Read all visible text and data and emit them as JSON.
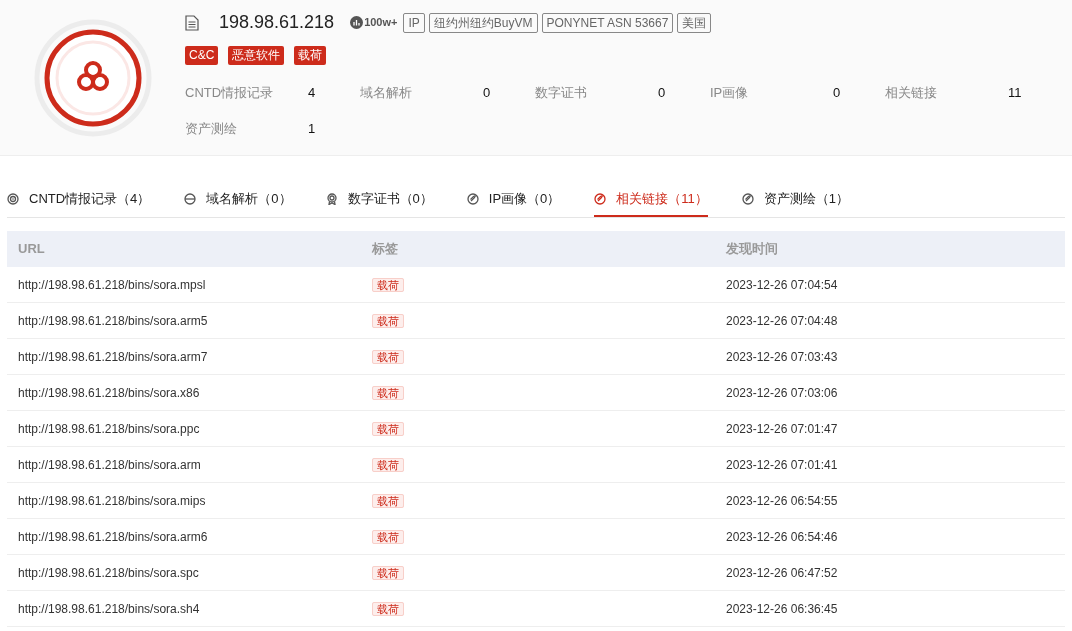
{
  "header": {
    "ip": "198.98.61.218",
    "popularity": "100w+",
    "info_tags": [
      "IP",
      "纽约州纽约BuyVM",
      "PONYNET ASN 53667",
      "美国"
    ],
    "threat_tags": [
      "C&C",
      "恶意软件",
      "载荷"
    ],
    "stats": [
      {
        "label": "CNTD情报记录",
        "value": "4"
      },
      {
        "label": "域名解析",
        "value": "0"
      },
      {
        "label": "数字证书",
        "value": "0"
      },
      {
        "label": "IP画像",
        "value": "0"
      },
      {
        "label": "相关链接",
        "value": "11"
      },
      {
        "label": "资产测绘",
        "value": "1"
      }
    ]
  },
  "tabs": [
    {
      "label": "CNTD情报记录",
      "count": "（4）",
      "selected": false
    },
    {
      "label": "域名解析",
      "count": "（0）",
      "selected": false
    },
    {
      "label": "数字证书",
      "count": "（0）",
      "selected": false
    },
    {
      "label": "IP画像",
      "count": "（0）",
      "selected": false
    },
    {
      "label": "相关链接",
      "count": "（11）",
      "selected": true
    },
    {
      "label": "资产测绘",
      "count": "（1）",
      "selected": false
    }
  ],
  "table": {
    "columns": [
      "URL",
      "标签",
      "发现时间"
    ],
    "rows": [
      {
        "url": "http://198.98.61.218/bins/sora.mpsl",
        "tag": "载荷",
        "time": "2023-12-26 07:04:54"
      },
      {
        "url": "http://198.98.61.218/bins/sora.arm5",
        "tag": "载荷",
        "time": "2023-12-26 07:04:48"
      },
      {
        "url": "http://198.98.61.218/bins/sora.arm7",
        "tag": "载荷",
        "time": "2023-12-26 07:03:43"
      },
      {
        "url": "http://198.98.61.218/bins/sora.x86",
        "tag": "载荷",
        "time": "2023-12-26 07:03:06"
      },
      {
        "url": "http://198.98.61.218/bins/sora.ppc",
        "tag": "载荷",
        "time": "2023-12-26 07:01:47"
      },
      {
        "url": "http://198.98.61.218/bins/sora.arm",
        "tag": "载荷",
        "time": "2023-12-26 07:01:41"
      },
      {
        "url": "http://198.98.61.218/bins/sora.mips",
        "tag": "载荷",
        "time": "2023-12-26 06:54:55"
      },
      {
        "url": "http://198.98.61.218/bins/sora.arm6",
        "tag": "载荷",
        "time": "2023-12-26 06:54:46"
      },
      {
        "url": "http://198.98.61.218/bins/sora.spc",
        "tag": "载荷",
        "time": "2023-12-26 06:47:52"
      },
      {
        "url": "http://198.98.61.218/bins/sora.sh4",
        "tag": "载荷",
        "time": "2023-12-26 06:36:45"
      }
    ]
  }
}
